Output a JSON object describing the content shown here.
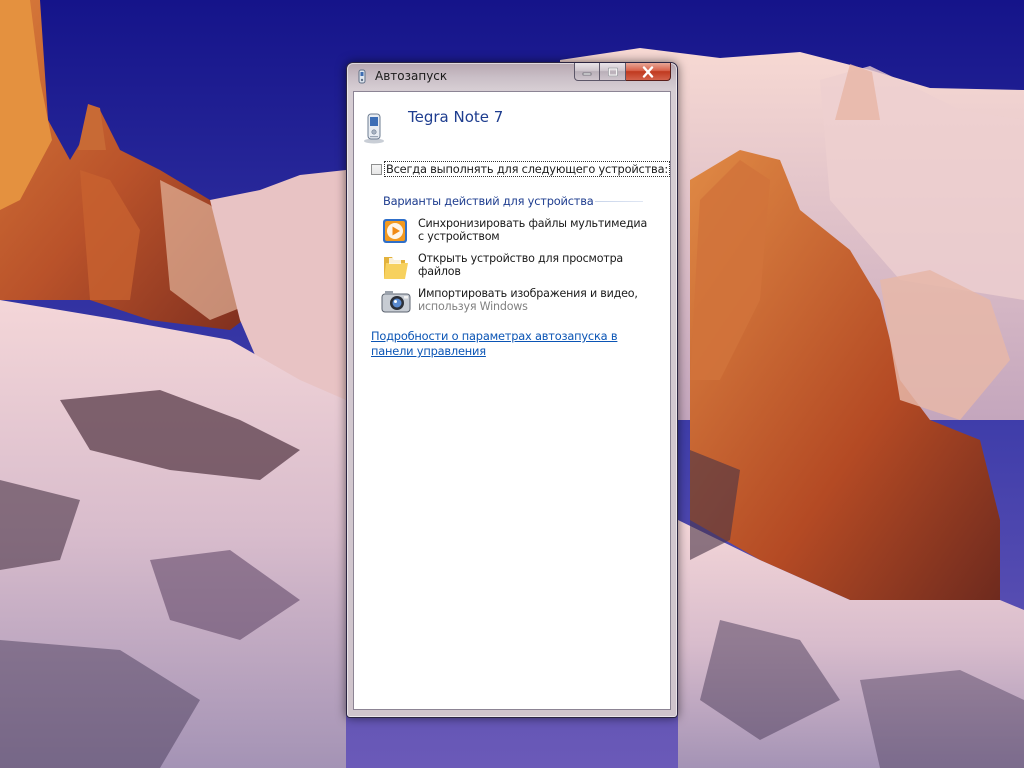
{
  "window": {
    "title": "Автозапуск",
    "device_name": "Tegra Note 7",
    "always_checkbox": {
      "label": "Всегда выполнять для следующего устройства:",
      "checked": false
    },
    "section_title": "Варианты действий для устройства",
    "options": [
      {
        "icon": "media-player-sync-icon",
        "label": "Синхронизировать файлы мультимедиа с устройством",
        "sub": ""
      },
      {
        "icon": "folder-icon",
        "label": "Открыть устройство для просмотра файлов",
        "sub": ""
      },
      {
        "icon": "camera-icon",
        "label": "Импортировать изображения и видео,",
        "sub": "используя Windows"
      }
    ],
    "help_link": "Подробности о параметрах автозапуска в панели управления"
  },
  "colors": {
    "accent": "#1e3d8f",
    "link": "#0b55b5",
    "close_button": "#c0391f"
  }
}
